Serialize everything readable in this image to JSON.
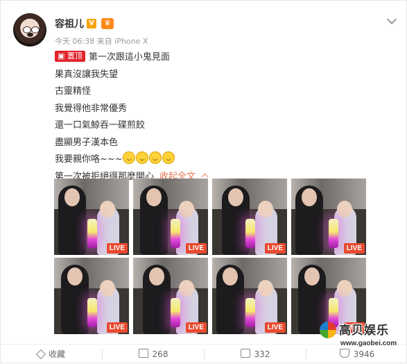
{
  "author": {
    "name": "容祖儿",
    "vip_badge": "V",
    "member_badge": "♛"
  },
  "meta": {
    "time": "今天 06:38",
    "source_prefix": "来自",
    "source": "iPhone X"
  },
  "post": {
    "pin_label": "置顶",
    "lines": [
      "第一次跟這小鬼見面",
      "果真沒讓我失望",
      "古靈精怪",
      "我覺得他非常優秀",
      "還一口氣鯨吞一碟煎餃",
      "盡顯男子漢本色",
      "我要親你咯~~~",
      "第一次被拒絕得那麼開心"
    ],
    "collapse_label": "收起全文"
  },
  "photos": {
    "live_label": "LIVE",
    "count": 8
  },
  "actions": {
    "favorite": "收藏",
    "repost": "268",
    "comment": "332",
    "like": "3946"
  },
  "watermark": {
    "brand": "高贝娱乐",
    "url": "www.gaobei.com"
  },
  "colors": {
    "accent": "#eb7350",
    "pin": "#e2242c",
    "live": "#e94a2f"
  }
}
